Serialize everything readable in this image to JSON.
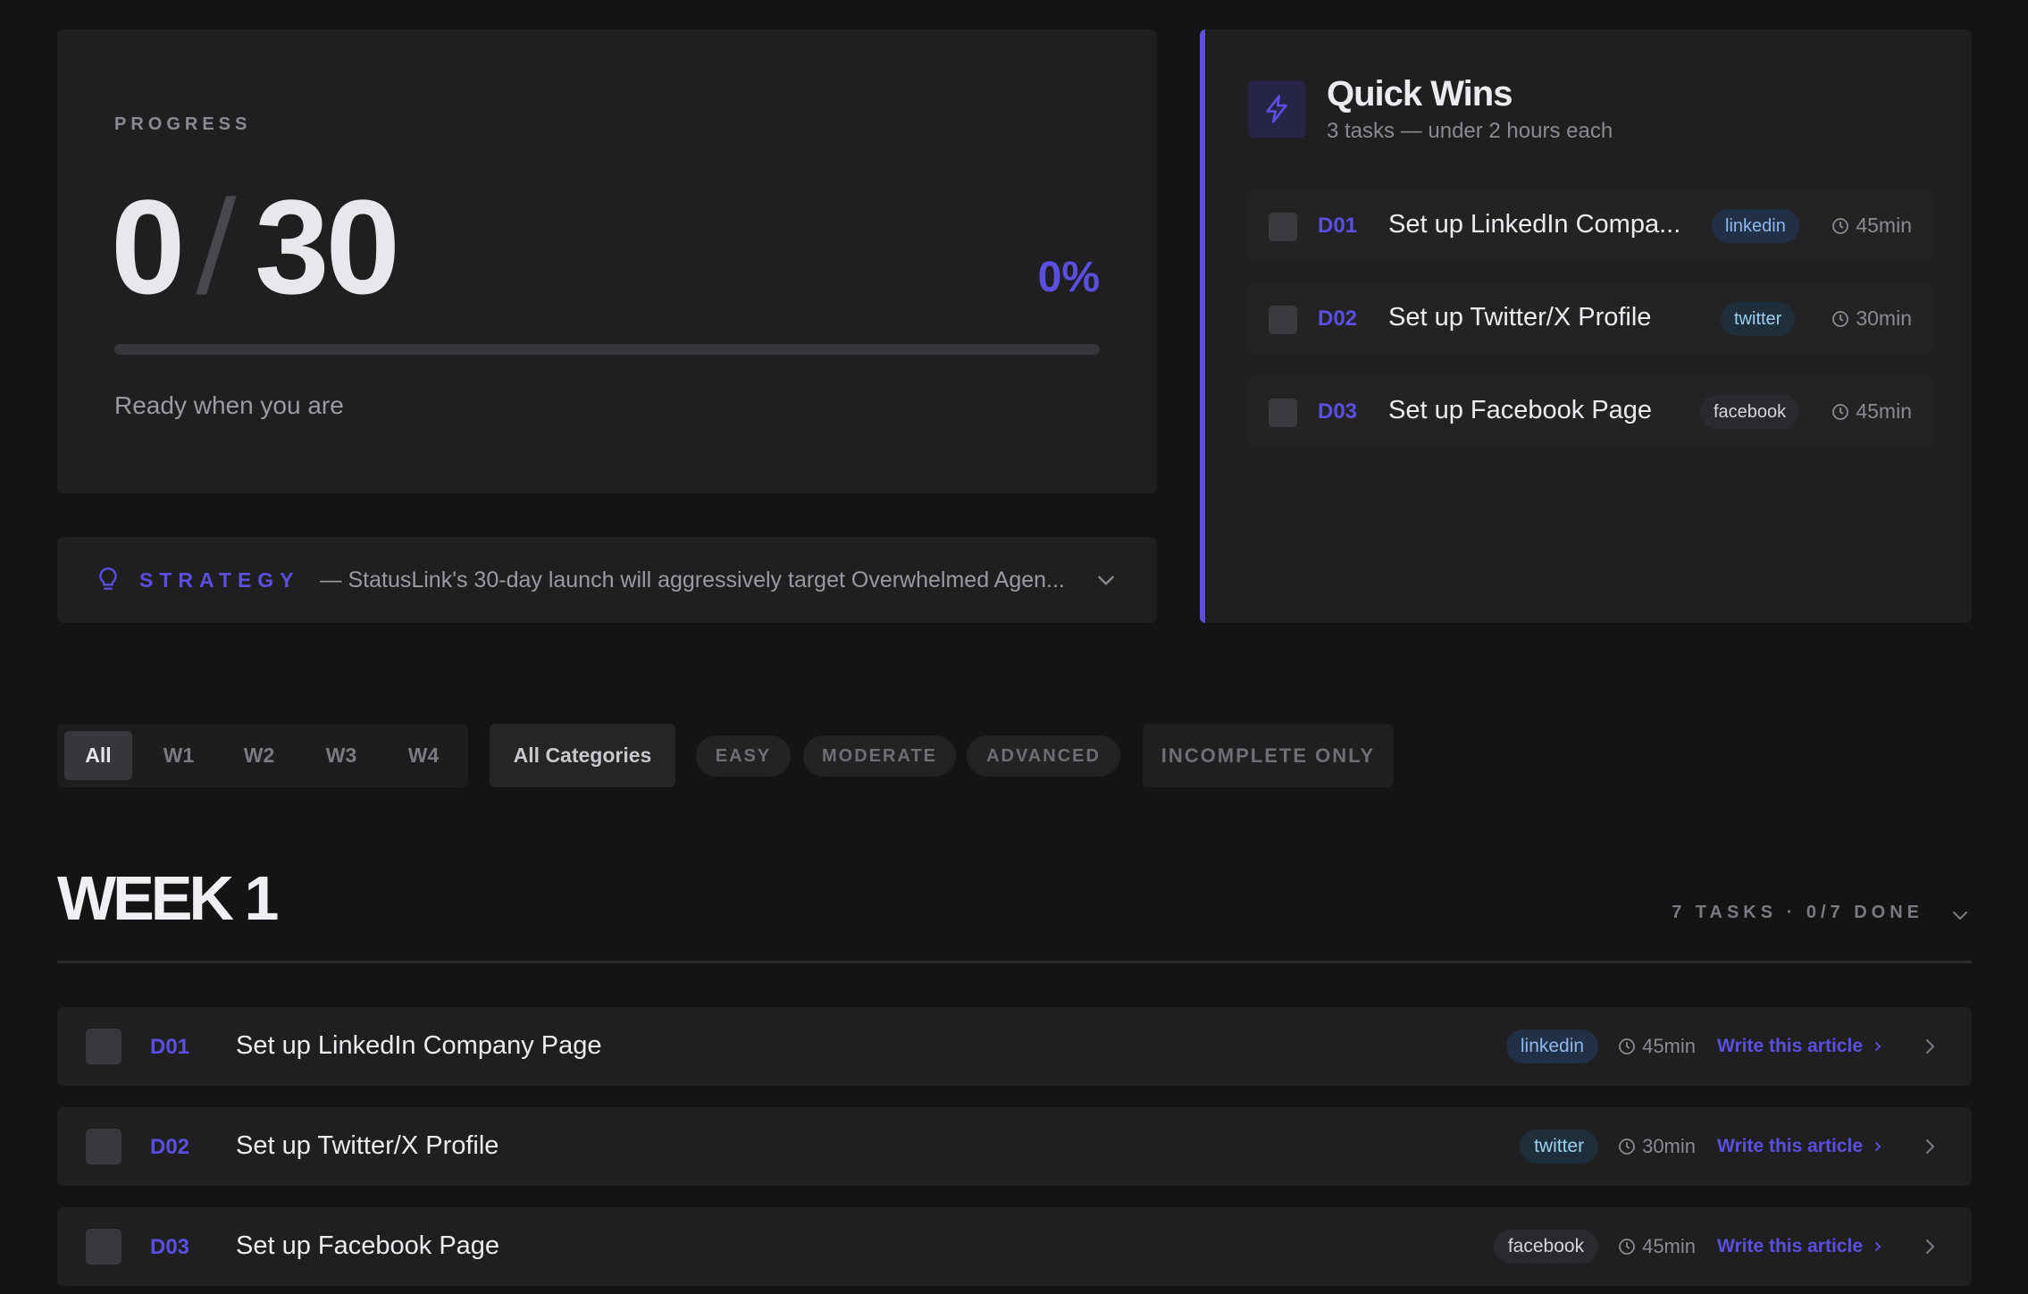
{
  "progress": {
    "label": "PROGRESS",
    "done": "0",
    "total": "30",
    "percent_label": "0%",
    "fraction": 0,
    "status": "Ready when you are"
  },
  "strategy": {
    "label": "STRATEGY",
    "text": "— StatusLink's 30-day launch will aggressively target Overwhelmed Agen..."
  },
  "quick_wins": {
    "title": "Quick Wins",
    "subtitle": "3 tasks — under 2 hours each",
    "items": [
      {
        "code": "D01",
        "title": "Set up LinkedIn Compa...",
        "tag": "linkedin",
        "time": "45min"
      },
      {
        "code": "D02",
        "title": "Set up Twitter/X Profile",
        "tag": "twitter",
        "time": "30min"
      },
      {
        "code": "D03",
        "title": "Set up Facebook Page",
        "tag": "facebook",
        "time": "45min"
      }
    ]
  },
  "filters": {
    "weeks": [
      "All",
      "W1",
      "W2",
      "W3",
      "W4"
    ],
    "active_week": "All",
    "category": "All Categories",
    "difficulty": [
      "EASY",
      "MODERATE",
      "ADVANCED"
    ],
    "incomplete": "INCOMPLETE ONLY"
  },
  "week": {
    "title": "WEEK 1",
    "meta": "7 TASKS · 0/7 DONE",
    "tasks": [
      {
        "code": "D01",
        "title": "Set up LinkedIn Company Page",
        "tag": "linkedin",
        "time": "45min",
        "action": "Write this article"
      },
      {
        "code": "D02",
        "title": "Set up Twitter/X Profile",
        "tag": "twitter",
        "time": "30min",
        "action": "Write this article"
      },
      {
        "code": "D03",
        "title": "Set up Facebook Page",
        "tag": "facebook",
        "time": "45min",
        "action": "Write this article"
      }
    ]
  },
  "colors": {
    "accent": "#5b4fe0",
    "background": "#141416",
    "card": "#1f1f22"
  },
  "icons": [
    "lightning-icon",
    "bulb-icon",
    "clock-icon",
    "chevron-down-icon",
    "chevron-right-icon"
  ]
}
